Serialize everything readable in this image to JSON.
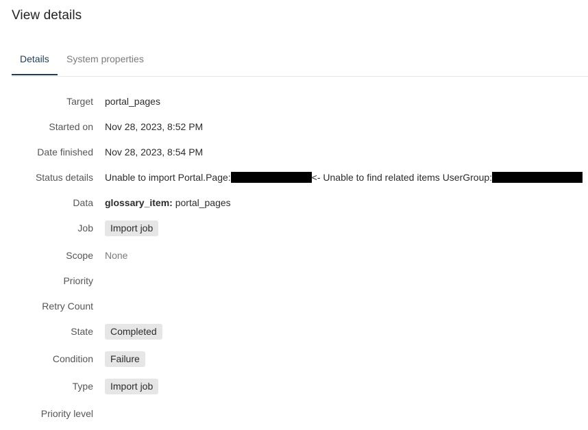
{
  "page": {
    "title": "View details"
  },
  "tabs": [
    {
      "label": "Details",
      "active": true
    },
    {
      "label": "System properties",
      "active": false
    }
  ],
  "fields": {
    "target": {
      "label": "Target",
      "value": "portal_pages"
    },
    "started_on": {
      "label": "Started on",
      "value": "Nov 28, 2023, 8:52 PM"
    },
    "date_finished": {
      "label": "Date finished",
      "value": "Nov 28, 2023, 8:54 PM"
    },
    "status_details": {
      "label": "Status details",
      "part1": "Unable to import Portal.Page:",
      "part2": "<- Unable to find related items UserGroup:"
    },
    "data": {
      "label": "Data",
      "key": "glossary_item:",
      "value": " portal_pages"
    },
    "job": {
      "label": "Job",
      "value": "Import job"
    },
    "scope": {
      "label": "Scope",
      "value": "None"
    },
    "priority": {
      "label": "Priority",
      "value": ""
    },
    "retry_count": {
      "label": "Retry Count",
      "value": ""
    },
    "state": {
      "label": "State",
      "value": "Completed"
    },
    "condition": {
      "label": "Condition",
      "value": "Failure"
    },
    "type": {
      "label": "Type",
      "value": "Import job"
    },
    "priority_level": {
      "label": "Priority level",
      "value": ""
    }
  },
  "colors": {
    "tab_active": "#1c3d5a",
    "pill_bg": "#e6e6e6",
    "redaction": "#000000"
  }
}
